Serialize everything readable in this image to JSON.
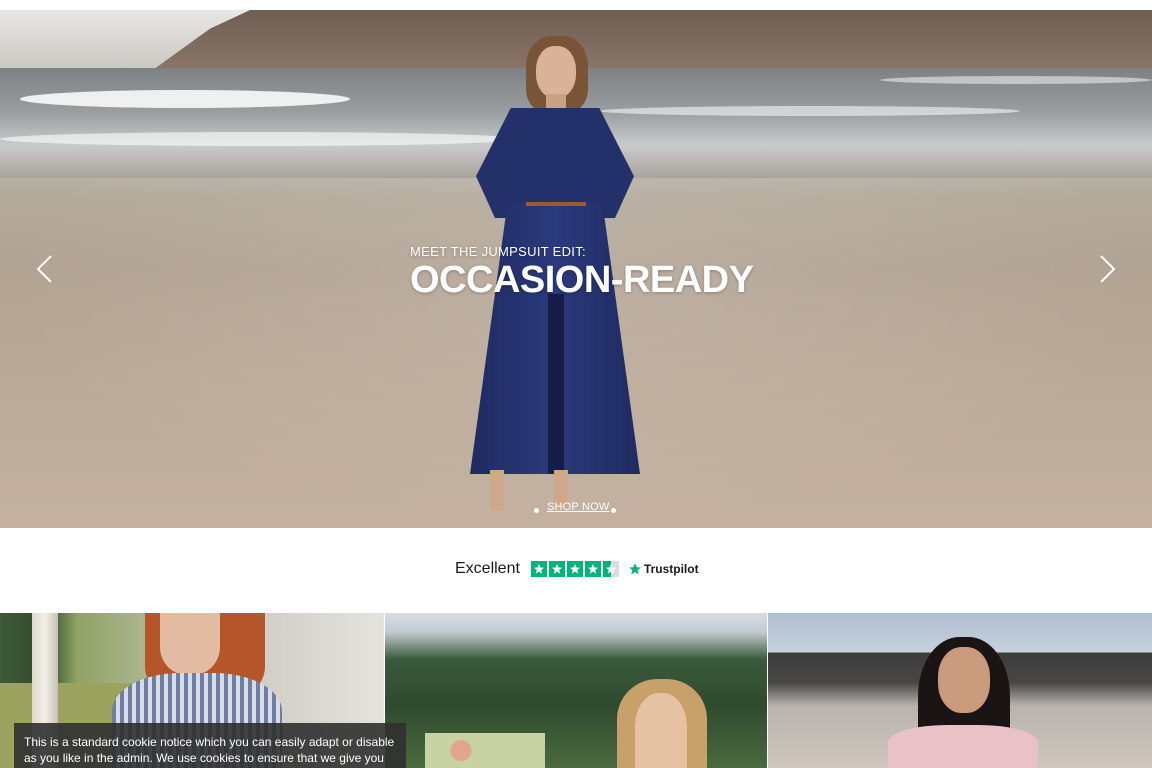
{
  "hero": {
    "eyebrow": "MEET THE JUMPSUIT EDIT:",
    "title": "OCCASION-READY",
    "cta": "SHOP NOW",
    "prev_icon": "chevron-left-icon",
    "next_icon": "chevron-right-icon",
    "slide_dots": 2
  },
  "trustpilot": {
    "rating_label": "Excellent",
    "brand": "Trustpilot",
    "stars_full": 4,
    "stars_half": 1,
    "star_color": "#00b67a"
  },
  "tiles": [
    {
      "icon": "photo-woman-striped-shirt"
    },
    {
      "icon": "photo-woman-forest"
    },
    {
      "icon": "photo-woman-pink-top"
    }
  ],
  "cookie": {
    "text": "This is a standard cookie notice which you can easily adapt or disable as you like in the admin. We use cookies to ensure that we give you"
  }
}
